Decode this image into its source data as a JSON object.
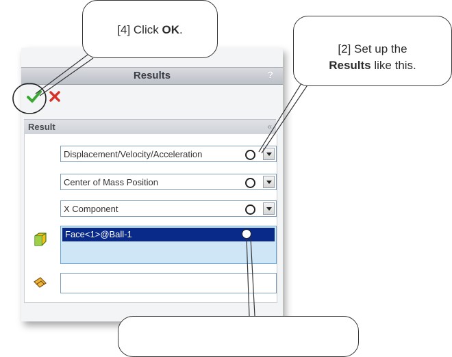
{
  "panel": {
    "title": "Results",
    "help_glyph": "?",
    "section_label": "Result",
    "collapse_glyph": "«"
  },
  "combos": [
    {
      "value": "Displacement/Velocity/Acceleration"
    },
    {
      "value": "Center of Mass Position"
    },
    {
      "value": "X Component"
    }
  ],
  "face_selection": {
    "value": "Face<1>@Ball-1"
  },
  "callouts": {
    "step4": {
      "prefix": "[4] Click ",
      "bold": "OK",
      "suffix": "."
    },
    "step2": {
      "line1": "[2] Set up the",
      "bold": "Results",
      "line2_suffix": " like this."
    }
  },
  "icons": {
    "ok": "checkmark-icon",
    "cancel": "close-icon",
    "face": "face-cube-icon",
    "reference": "reference-entity-icon"
  },
  "colors": {
    "ok_green": "#3aa832",
    "cancel_red": "#d9302a",
    "selection_blue": "#0a2a8a",
    "list_highlight": "#cfe6f7"
  }
}
